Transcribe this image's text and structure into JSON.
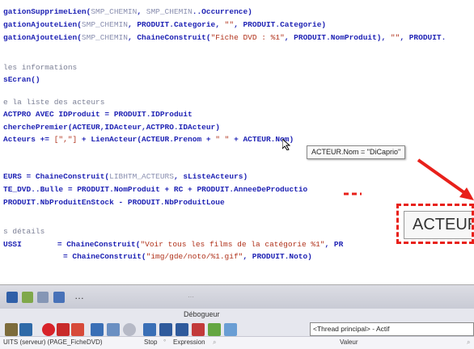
{
  "code": {
    "l1": {
      "a": "gationSupprimeLien(",
      "b": "SMP_CHEMIN",
      "c": ", ",
      "d": "SMP_CHEMIN",
      "e": "..Occurrence)"
    },
    "l2": {
      "a": "gationAjouteLien(",
      "b": "SMP_CHEMIN",
      "c": ", PRODUIT.Categorie, ",
      "d": "\"\"",
      "e": ", PRODUIT.Categorie)"
    },
    "l3": {
      "a": "gationAjouteLien(",
      "b": "SMP_CHEMIN",
      "c": ", ChaineConstruit(",
      "d": "\"Fiche DVD : %1\"",
      "e": ", PRODUIT.NomProduit), ",
      "f": "\"\"",
      "g": ", PRODUIT."
    },
    "l4": "les informations",
    "l5": "sEcran()",
    "l6": "e la liste des acteurs",
    "l7": {
      "a": "ACTPRO AVEC ",
      "b": "IDProduit = PRODUIT.IDProduit"
    },
    "l8": "cherchePremier(ACTEUR,IDActeur,ACTPRO.IDActeur)",
    "l9": {
      "a": "Acteurs += ",
      "b": "[\",\"]",
      "c": " + LienActeur(ACTEUR.Prenom + ",
      "d": "\" \"",
      "e": " + ACTEUR.Nom)"
    },
    "l10": {
      "a": "EURS = ChaineConstruit(",
      "b": "LIBHTM_ACTEURS",
      "c": ", sListeActeurs)"
    },
    "l11": "TE_DVD..Bulle = PRODUIT.NomProduit + RC + PRODUIT.AnneeDeProductio",
    "l12": "PRODUIT.NbProduitEnStock - PRODUIT.NbProduitLoue",
    "l13": "s détails",
    "l14": {
      "a": "USSI",
      "b": "= ChaineConstruit(",
      "c": "\"Voir tous les films de la catégorie %1\"",
      "d": ", PR"
    },
    "l15": {
      "a": "= ChaineConstruit(",
      "b": "\"img/gde/noto/%1.gif\"",
      "c": ", PRODUIT.Noto)"
    }
  },
  "tooltip": "ACTEUR.Nom = \"DiCaprio\"",
  "zoom_text": "ACTEUR.Nom",
  "debugger": {
    "title": "Débogueur",
    "thread": "<Thread principal> - Actif",
    "col_stop": "Stop",
    "col_expression": "Expression",
    "col_valeur": "Valeur",
    "context": "UITS (serveur) (PAGE_FicheDVD)",
    "dots": "···"
  }
}
